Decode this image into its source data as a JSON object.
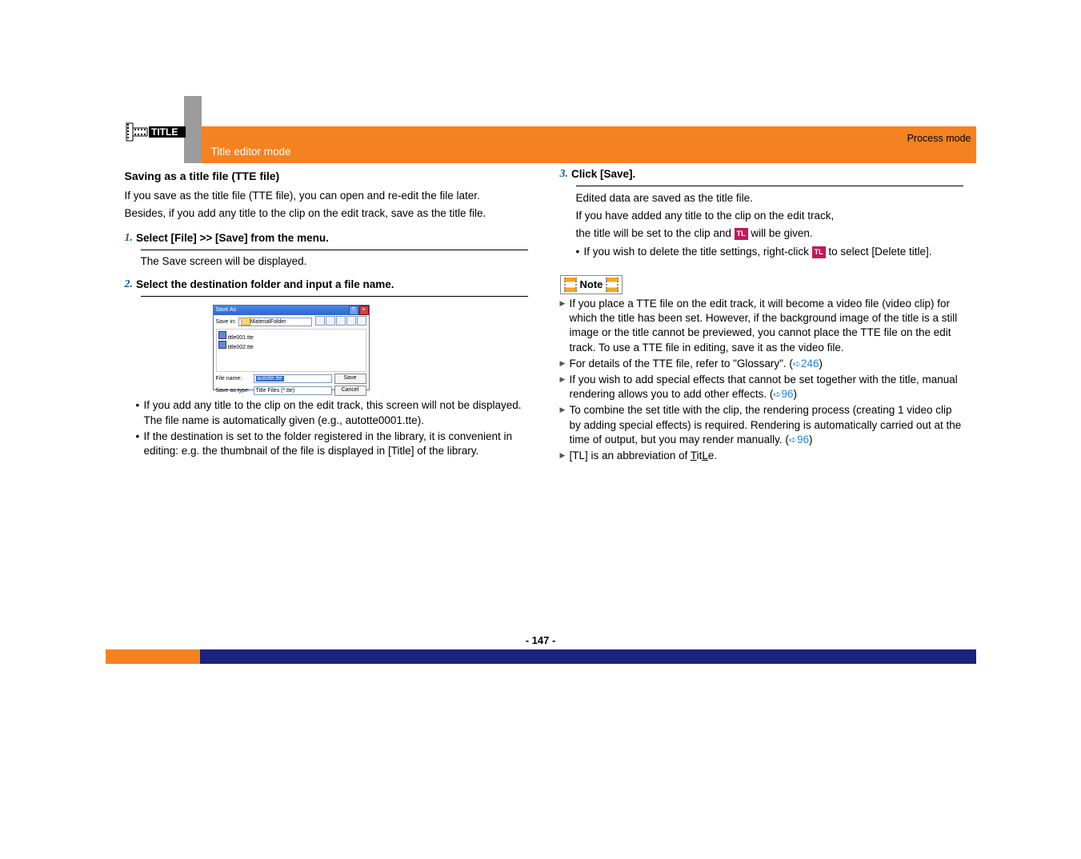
{
  "header": {
    "process_mode": "Process mode",
    "section": "Title editor mode"
  },
  "left": {
    "heading": "Saving as a title file (TTE file)",
    "intro1": "If you save as the title file (TTE file), you can open and re-edit the file later.",
    "intro2": "Besides, if you add any title to the clip on the edit track, save as the title file.",
    "step1_num": "1.",
    "step1": "Select [File] >> [Save] from the menu.",
    "step1_sub": "The Save screen will be displayed.",
    "step2_num": "2.",
    "step2": "Select the destination folder and input a file name.",
    "dialog": {
      "title": "Save As",
      "savein_label": "Save in:",
      "savein_value": "MaterialFolder",
      "file1": "title001.tte",
      "file2": "title002.tte",
      "filename_label": "File name:",
      "filename_value": "autotte.tte",
      "type_label": "Save as type:",
      "type_value": "Title Files (*.tte)",
      "save_btn": "Save",
      "cancel_btn": "Cancel"
    },
    "bullets": [
      "If you add any title to the clip on the edit track, this screen will not be displayed. The file name is automatically given (e.g., autotte0001.tte).",
      "If the destination is set to the folder registered in the library, it is convenient in editing: e.g. the thumbnail of the file is displayed in [Title] of the library."
    ]
  },
  "right": {
    "step3_num": "3.",
    "step3": "Click [Save].",
    "r_p1": "Edited data are saved as the title file.",
    "r_p2": "If you have added any title to the clip on the edit track,",
    "r_p3a": "the title will be set to the clip and ",
    "r_p3b": " will be given.",
    "r_bullet_a": "If you wish to delete the title settings, right-click ",
    "r_bullet_b": " to select [Delete title].",
    "note_label": "Note",
    "notes": {
      "n1": "If you place a TTE file on the edit track, it will become a video file (video clip) for which the title has been set. However, if the background image of the title is a still image or the title cannot be previewed, you cannot place the TTE file on the edit track. To use a TTE file in editing, save it as the video file.",
      "n2a": "For details of the TTE file, refer to \"Glossary\". (",
      "n2b": "246",
      "n2c": ")",
      "n3a": "If you wish to add special effects that cannot be set together with the title, manual rendering allows you to add other effects. (",
      "n3b": "96",
      "n3c": ")",
      "n4a": "To combine the set title with the clip, the rendering process (creating 1 video clip by adding special effects) is required. Rendering is automatically carried out at the time of output, but you may render manually. (",
      "n4b": "96",
      "n4c": ")",
      "n5a": "[TL] is an abbreviation of ",
      "n5b": "T",
      "n5c": "it",
      "n5d": "L",
      "n5e": "e."
    },
    "icon_text": "TL"
  },
  "page_number": "- 147 -"
}
